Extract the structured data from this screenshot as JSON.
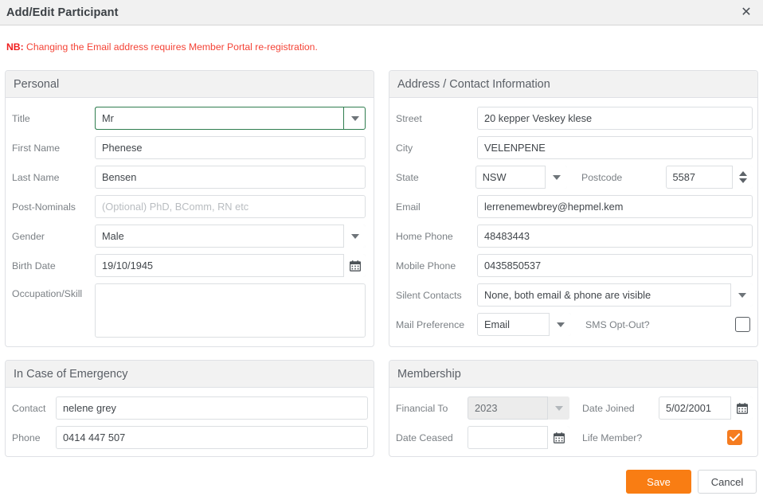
{
  "window": {
    "title": "Add/Edit Participant",
    "close_icon": "close-icon"
  },
  "notice": {
    "prefix": "NB:",
    "text": " Changing the Email address requires Member Portal re-registration.",
    "color": "#f44336"
  },
  "personal": {
    "heading": "Personal",
    "title": {
      "label": "Title",
      "value": "Mr",
      "focused": true
    },
    "first_name": {
      "label": "First Name",
      "value": "Phenese"
    },
    "last_name": {
      "label": "Last Name",
      "value": "Bensen"
    },
    "post_nominals": {
      "label": "Post-Nominals",
      "value": "",
      "placeholder": "(Optional) PhD, BComm, RN etc"
    },
    "gender": {
      "label": "Gender",
      "value": "Male"
    },
    "birth_date": {
      "label": "Birth Date",
      "value": "19/10/1945"
    },
    "occupation": {
      "label": "Occupation/Skill",
      "value": ""
    }
  },
  "address": {
    "heading": "Address / Contact Information",
    "street": {
      "label": "Street",
      "value": "20 kepper Veskey klese"
    },
    "city": {
      "label": "City",
      "value": "VELENPENE"
    },
    "state": {
      "label": "State",
      "value": "NSW"
    },
    "postcode": {
      "label": "Postcode",
      "value": "5587"
    },
    "email": {
      "label": "Email",
      "value": "lerrenemewbrey@hepmel.kem"
    },
    "home_phone": {
      "label": "Home Phone",
      "value": "48483443"
    },
    "mobile_phone": {
      "label": "Mobile Phone",
      "value": "0435850537"
    },
    "silent_contacts": {
      "label": "Silent Contacts",
      "value": "None, both email & phone are visible"
    },
    "mail_preference": {
      "label": "Mail Preference",
      "value": "Email"
    },
    "sms_opt_out": {
      "label": "SMS Opt-Out?",
      "checked": false
    }
  },
  "emergency": {
    "heading": "In Case of Emergency",
    "contact": {
      "label": "Contact",
      "value": "nelene grey"
    },
    "phone": {
      "label": "Phone",
      "value": "0414 447 507"
    }
  },
  "membership": {
    "heading": "Membership",
    "financial_to": {
      "label": "Financial To",
      "value": "2023",
      "disabled": true
    },
    "date_joined": {
      "label": "Date Joined",
      "value": "5/02/2001"
    },
    "date_ceased": {
      "label": "Date Ceased",
      "value": ""
    },
    "life_member": {
      "label": "Life Member?",
      "checked": true
    }
  },
  "footer": {
    "save_label": "Save",
    "cancel_label": "Cancel",
    "save_color": "#f97d13"
  }
}
